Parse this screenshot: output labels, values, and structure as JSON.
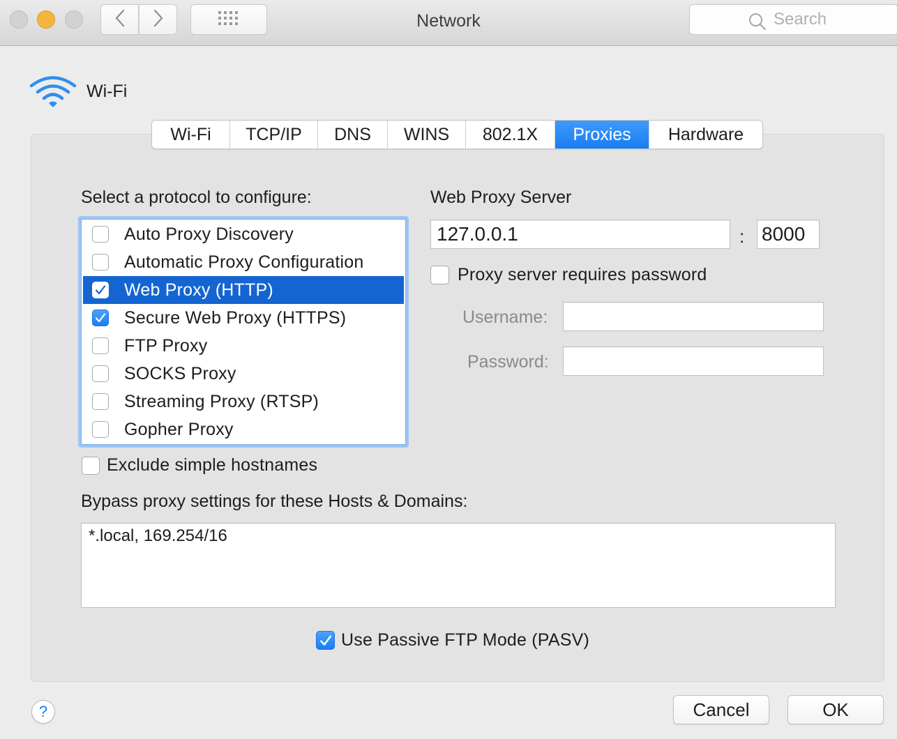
{
  "window": {
    "title": "Network"
  },
  "search": {
    "placeholder": "Search"
  },
  "header": {
    "interface_name": "Wi-Fi"
  },
  "tabs": [
    {
      "label": "Wi-Fi",
      "active": false
    },
    {
      "label": "TCP/IP",
      "active": false
    },
    {
      "label": "DNS",
      "active": false
    },
    {
      "label": "WINS",
      "active": false
    },
    {
      "label": "802.1X",
      "active": false
    },
    {
      "label": "Proxies",
      "active": true
    },
    {
      "label": "Hardware",
      "active": false
    }
  ],
  "protocols": {
    "heading": "Select a protocol to configure:",
    "items": [
      {
        "label": "Auto Proxy Discovery",
        "checked": false,
        "selected": false
      },
      {
        "label": "Automatic Proxy Configuration",
        "checked": false,
        "selected": false
      },
      {
        "label": "Web Proxy (HTTP)",
        "checked": true,
        "selected": true
      },
      {
        "label": "Secure Web Proxy (HTTPS)",
        "checked": true,
        "selected": false
      },
      {
        "label": "FTP Proxy",
        "checked": false,
        "selected": false
      },
      {
        "label": "SOCKS Proxy",
        "checked": false,
        "selected": false
      },
      {
        "label": "Streaming Proxy (RTSP)",
        "checked": false,
        "selected": false
      },
      {
        "label": "Gopher Proxy",
        "checked": false,
        "selected": false
      }
    ]
  },
  "proxy_server": {
    "heading": "Web Proxy Server",
    "host": "127.0.0.1",
    "separator": ":",
    "port": "8000",
    "requires_password_label": "Proxy server requires password",
    "requires_password": false,
    "username_label": "Username:",
    "username": "",
    "password_label": "Password:",
    "password": ""
  },
  "exclude_simple_hostnames": {
    "label": "Exclude simple hostnames",
    "checked": false
  },
  "bypass": {
    "label": "Bypass proxy settings for these Hosts & Domains:",
    "value": "*.local, 169.254/16"
  },
  "passive_ftp": {
    "label": "Use Passive FTP Mode (PASV)",
    "checked": true
  },
  "footer": {
    "help_label": "?",
    "cancel_label": "Cancel",
    "ok_label": "OK"
  },
  "colors": {
    "accent": "#1a7cf3",
    "selection": "#1465d1",
    "focus_ring": "#9ec4f3"
  }
}
